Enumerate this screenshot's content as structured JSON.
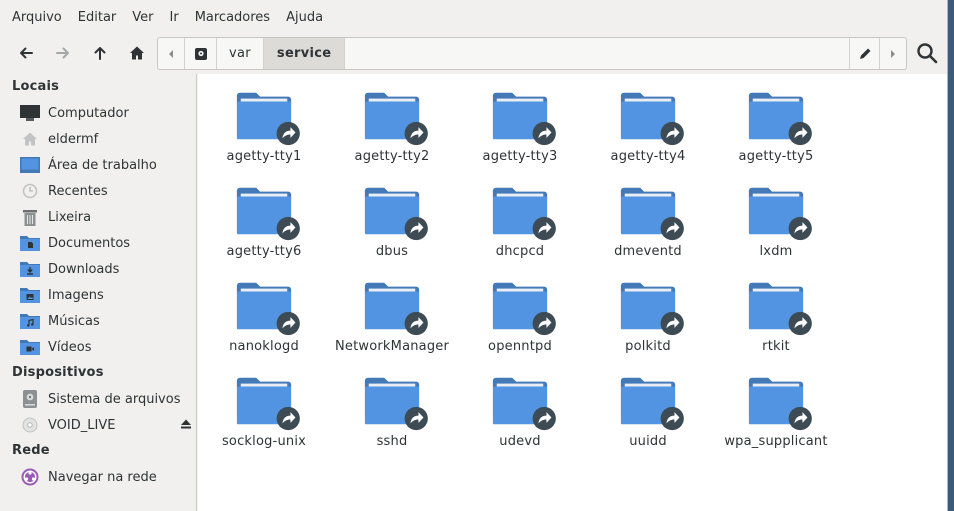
{
  "menubar": {
    "items": [
      "Arquivo",
      "Editar",
      "Ver",
      "Ir",
      "Marcadores",
      "Ajuda"
    ]
  },
  "toolbar": {
    "back_icon": "arrow-left-icon",
    "forward_icon": "arrow-right-icon",
    "up_icon": "arrow-up-icon",
    "home_icon": "home-icon",
    "path": [
      "var",
      "service"
    ],
    "active_segment": "service",
    "edit_icon": "pencil-icon",
    "search_icon": "search-icon"
  },
  "sidebar": {
    "sections": [
      {
        "heading": "Locais",
        "items": [
          {
            "label": "Computador",
            "icon": "monitor-icon"
          },
          {
            "label": "eldermf",
            "icon": "home-icon"
          },
          {
            "label": "Área de trabalho",
            "icon": "desktop-icon"
          },
          {
            "label": "Recentes",
            "icon": "clock-icon"
          },
          {
            "label": "Lixeira",
            "icon": "trash-icon"
          },
          {
            "label": "Documentos",
            "icon": "folder-documents-icon"
          },
          {
            "label": "Downloads",
            "icon": "folder-download-icon"
          },
          {
            "label": "Imagens",
            "icon": "folder-pictures-icon"
          },
          {
            "label": "Músicas",
            "icon": "folder-music-icon"
          },
          {
            "label": "Vídeos",
            "icon": "folder-videos-icon"
          }
        ]
      },
      {
        "heading": "Dispositivos",
        "items": [
          {
            "label": "Sistema de arquivos",
            "icon": "harddisk-icon"
          },
          {
            "label": "VOID_LIVE",
            "icon": "disc-icon"
          }
        ]
      },
      {
        "heading": "Rede",
        "items": [
          {
            "label": "Navegar na rede",
            "icon": "network-icon"
          }
        ]
      }
    ]
  },
  "files": [
    "agetty-tty1",
    "agetty-tty2",
    "agetty-tty3",
    "agetty-tty4",
    "agetty-tty5",
    "agetty-tty6",
    "dbus",
    "dhcpcd",
    "dmeventd",
    "lxdm",
    "nanoklogd",
    "NetworkManager",
    "openntpd",
    "polkitd",
    "rtkit",
    "socklog-unix",
    "sshd",
    "udevd",
    "uuidd",
    "wpa_supplicant"
  ],
  "file_icon": "folder-symlink-icon",
  "colors": {
    "folder": "#5294e2",
    "folder_dark": "#4479b8",
    "symlink_badge": "#3d4b55"
  }
}
